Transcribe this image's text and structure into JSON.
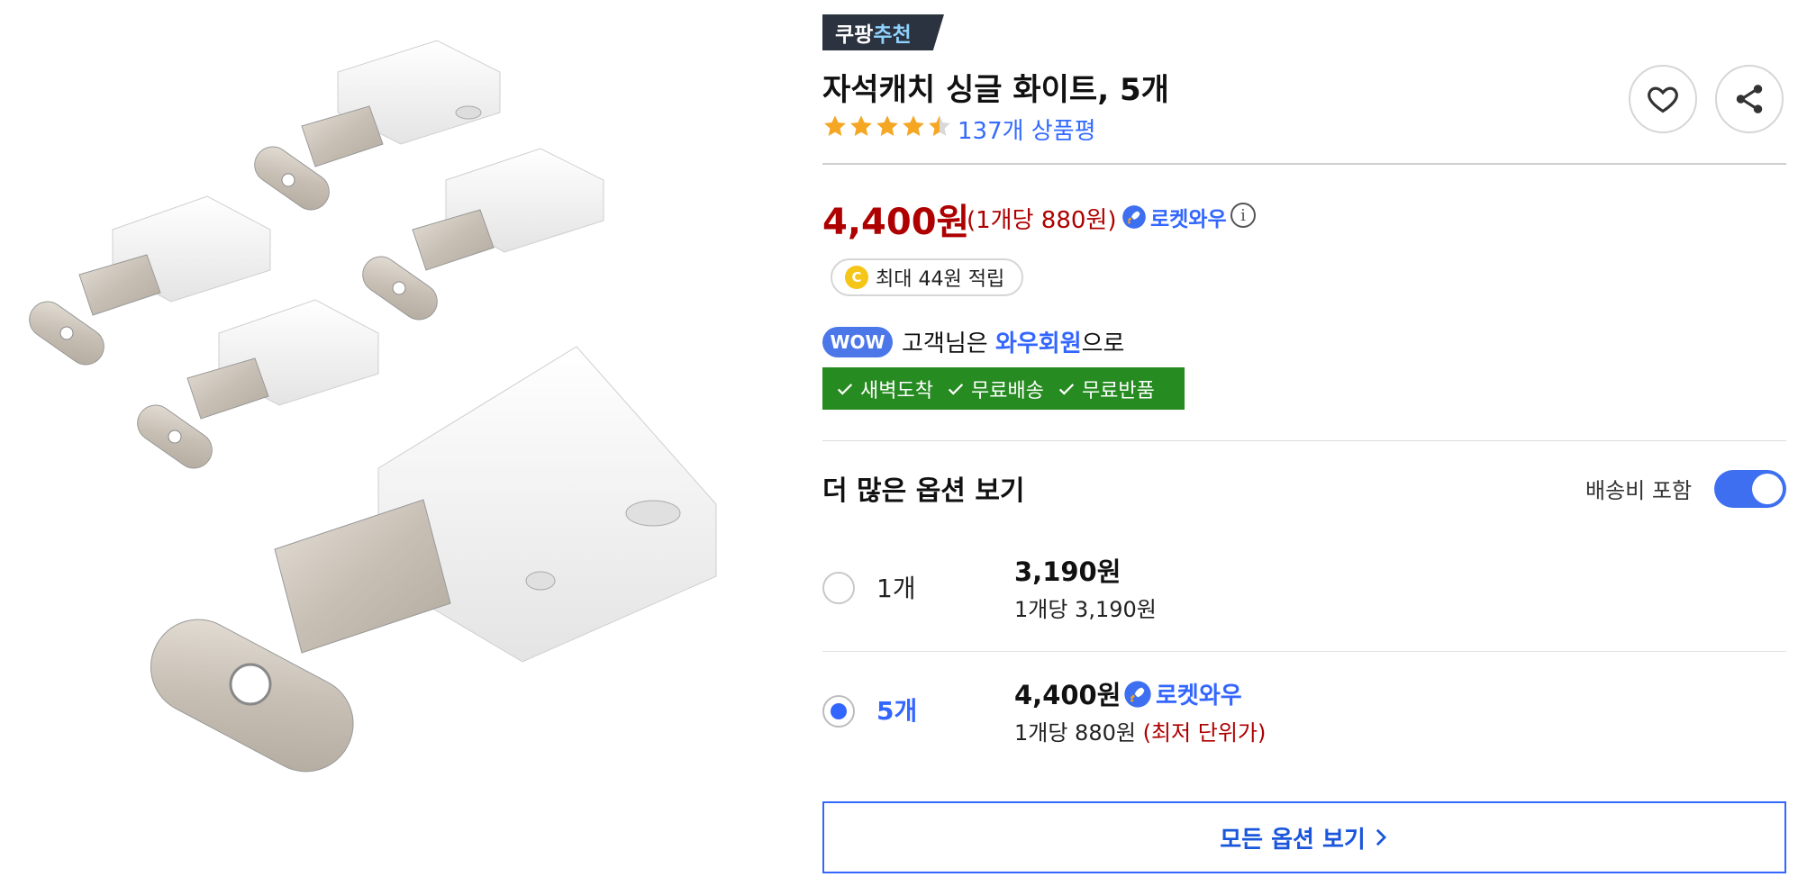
{
  "badge": {
    "part1": "쿠팡",
    "part2": "추천"
  },
  "product": {
    "title": "자석캐치 싱글 화이트, 5개",
    "rating": 4.5,
    "review_count": "137개 상품평"
  },
  "price": {
    "main": "4,400원",
    "unit": "(1개당 880원)",
    "rocket_label": "로켓와우"
  },
  "cash": {
    "coin_letter": "C",
    "text": "최대 44원 적립"
  },
  "wow": {
    "badge": "WOW",
    "text_before": "고객님은 ",
    "text_highlight": "와우회원",
    "text_after": "으로"
  },
  "benefits": [
    "새벽도착",
    "무료배송",
    "무료반품"
  ],
  "options": {
    "heading": "더 많은 옵션 보기",
    "shipping_toggle_label": "배송비 포함",
    "shipping_toggle_on": true,
    "items": [
      {
        "label": "1개",
        "price": "3,190원",
        "unit_price": "1개당 3,190원",
        "selected": false
      },
      {
        "label": "5개",
        "price": "4,400원",
        "rocket_label": "로켓와우",
        "unit_price": "1개당 880원",
        "unit_note": "(최저 단위가)",
        "selected": true
      }
    ],
    "view_all": "모든 옵션 보기"
  },
  "colors": {
    "price_red": "#ae0000",
    "accent_blue": "#3366ff",
    "benefit_green": "#268b20",
    "star_orange": "#f5a623"
  },
  "icons": [
    "heart-icon",
    "share-icon",
    "rocket-icon",
    "info-icon",
    "check-icon",
    "chevron-right-icon"
  ]
}
